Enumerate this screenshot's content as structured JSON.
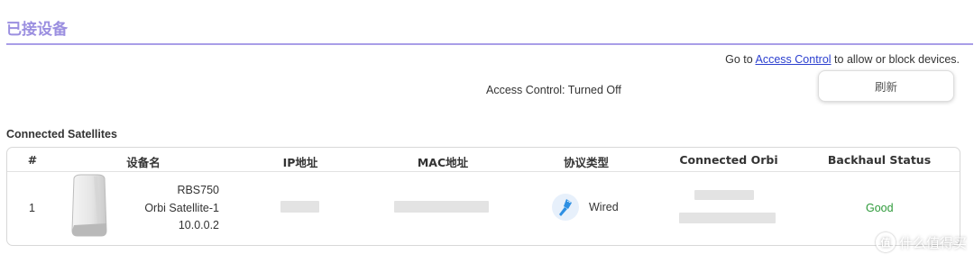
{
  "header": {
    "title": "已接设备"
  },
  "access_control": {
    "prefix": "Go to",
    "link_text": "Access Control",
    "suffix": "to allow or block devices.",
    "status": "Access Control: Turned Off"
  },
  "toolbar": {
    "refresh_label": "刷新"
  },
  "section": {
    "title": "Connected Satellites"
  },
  "table": {
    "columns": [
      "#",
      "设备名",
      "IP地址",
      "MAC地址",
      "协议类型",
      "Connected Orbi",
      "Backhaul Status"
    ],
    "rows": [
      {
        "index": "1",
        "model": "RBS750",
        "name": "Orbi Satellite-1",
        "firmware": "10.0.0.2",
        "protocol": "Wired",
        "backhaul_status": "Good",
        "icon": "ethernet-cable-icon"
      }
    ]
  },
  "colors": {
    "accent": "#9b8fe0",
    "link": "#2b3fcf",
    "status_good": "#2e9a3a"
  },
  "watermark": {
    "text": "什么值得买",
    "icon_glyph": "值"
  }
}
